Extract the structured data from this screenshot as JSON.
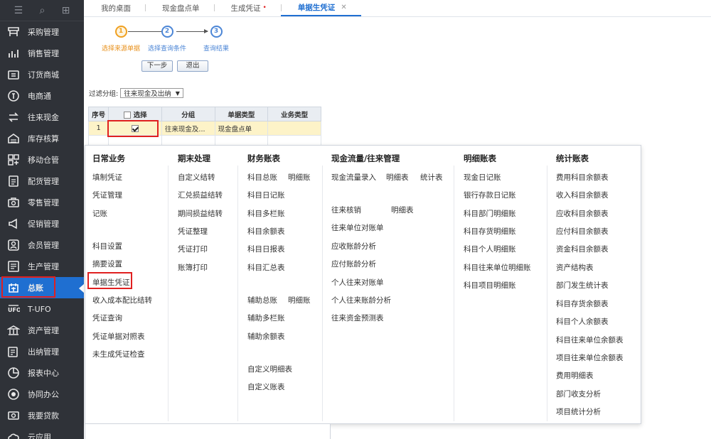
{
  "sidebar": {
    "items": [
      {
        "label": "采购管理",
        "icon": "purchase-icon"
      },
      {
        "label": "销售管理",
        "icon": "sales-chart-icon"
      },
      {
        "label": "订货商城",
        "icon": "store-icon"
      },
      {
        "label": "电商通",
        "icon": "ecommerce-icon"
      },
      {
        "label": "往来现金",
        "icon": "exchange-icon"
      },
      {
        "label": "库存核算",
        "icon": "warehouse-icon"
      },
      {
        "label": "移动仓管",
        "icon": "mobile-warehouse-icon"
      },
      {
        "label": "配货管理",
        "icon": "distribution-icon"
      },
      {
        "label": "零售管理",
        "icon": "retail-icon"
      },
      {
        "label": "促销管理",
        "icon": "promotion-icon"
      },
      {
        "label": "会员管理",
        "icon": "member-icon"
      },
      {
        "label": "生产管理",
        "icon": "production-icon"
      },
      {
        "label": "总账",
        "icon": "ledger-icon",
        "active": true
      },
      {
        "label": "T-UFO",
        "icon": "ufo-icon"
      },
      {
        "label": "资产管理",
        "icon": "asset-icon"
      },
      {
        "label": "出纳管理",
        "icon": "cashier-icon"
      },
      {
        "label": "报表中心",
        "icon": "report-icon"
      },
      {
        "label": "协同办公",
        "icon": "collaboration-icon"
      },
      {
        "label": "我要贷款",
        "icon": "loan-icon"
      },
      {
        "label": "云应用",
        "icon": "cloud-icon"
      }
    ]
  },
  "tabs": [
    {
      "label": "我的桌面"
    },
    {
      "label": "现金盘点单"
    },
    {
      "label": "生成凭证",
      "dot": "•"
    },
    {
      "label": "单据生凭证",
      "active": true,
      "close": "✕"
    }
  ],
  "steps": [
    {
      "num": "1",
      "label": "选择来源单据",
      "current": true
    },
    {
      "num": "2",
      "label": "选择查询条件"
    },
    {
      "num": "3",
      "label": "查询结果"
    }
  ],
  "buttons": {
    "next": "下一步",
    "exit": "退出"
  },
  "filter": {
    "label": "过滤分组:",
    "value": "往来现金及出纳"
  },
  "grid": {
    "headers": [
      "序号",
      "选择",
      "分组",
      "单据类型",
      "业务类型"
    ],
    "rows": [
      {
        "no": "1",
        "checked": true,
        "group": "往来现金及...",
        "doctype": "现金盘点单",
        "biztype": ""
      }
    ]
  },
  "menu": {
    "daily": {
      "title": "日常业务",
      "items": [
        "填制凭证",
        "凭证管理",
        "记账",
        "科目设置",
        "摘要设置",
        "单据生凭证",
        "收入成本配比结转",
        "凭证查询",
        "凭证单据对照表",
        "未生成凭证检查"
      ]
    },
    "period": {
      "title": "期末处理",
      "items": [
        "自定义结转",
        "汇兑损益结转",
        "期间损益结转",
        "凭证整理",
        "凭证打印",
        "账簿打印"
      ]
    },
    "finance": {
      "title": "财务账表",
      "items": [
        "科目总账",
        "明细账",
        "科目日记账",
        "科目多栏账",
        "科目余额表",
        "科目日报表",
        "科目汇总表",
        "辅助总账",
        "明细账",
        "辅助多栏账",
        "辅助余额表",
        "自定义明细表",
        "自定义账表"
      ]
    },
    "cashflow": {
      "title": "现金流量/往来管理",
      "items": [
        "现金流量录入",
        "明细表",
        "统计表",
        "往来核销",
        "明细表",
        "往来单位对账单",
        "应收账龄分析",
        "应付账龄分析",
        "个人往来对账单",
        "个人往来账龄分析",
        "往来资金预测表"
      ]
    },
    "detail": {
      "title": "明细账表",
      "items": [
        "现金日记账",
        "银行存款日记账",
        "科目部门明细账",
        "科目存货明细账",
        "科目个人明细账",
        "科目往来单位明细账",
        "科目项目明细账"
      ]
    },
    "stats": {
      "title": "统计账表",
      "items": [
        "费用科目余额表",
        "收入科目余额表",
        "应收科目余额表",
        "应付科目余额表",
        "资金科目余额表",
        "资产结构表",
        "部门发生统计表",
        "科目存货余额表",
        "科目个人余额表",
        "科目往来单位余额表",
        "项目往来单位余额表",
        "费用明细表",
        "部门收支分析",
        "项目统计分析"
      ]
    }
  },
  "colors": {
    "accent": "#1f6fd1",
    "sidebar": "#2f3238",
    "highlight": "#e02020",
    "step_current": "#f0a020"
  }
}
